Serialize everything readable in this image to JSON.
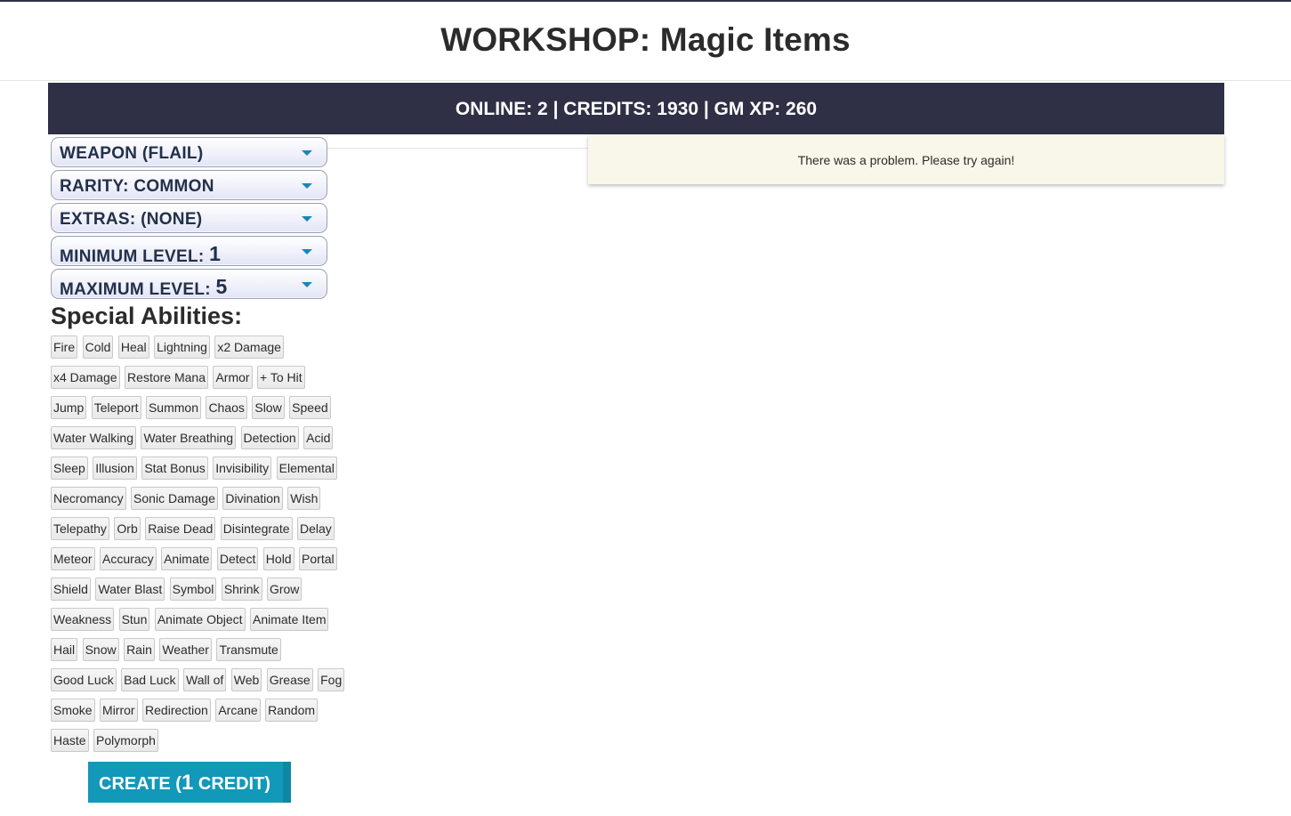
{
  "page": {
    "title": "WORKSHOP: Magic Items"
  },
  "status": {
    "text": "ONLINE: 2 | CREDITS: 1930 | GM XP: 260"
  },
  "alert": {
    "message": "There was a problem. Please try again!"
  },
  "filters": {
    "item_type": "WEAPON (FLAIL)",
    "rarity": "RARITY: COMMON",
    "extras": "EXTRAS: (NONE)",
    "min_level_label": "MINIMUM LEVEL: ",
    "min_level_value": "1",
    "max_level_label": "MAXIMUM LEVEL: ",
    "max_level_value": "5"
  },
  "abilities": {
    "heading": "Special Abilities:",
    "rows": [
      [
        "Fire",
        "Cold",
        "Heal",
        "Lightning",
        "x2 Damage"
      ],
      [
        "x4 Damage",
        "Restore Mana",
        "Armor",
        "+ To Hit"
      ],
      [
        "Jump",
        "Teleport",
        "Summon",
        "Chaos",
        "Slow",
        "Speed"
      ],
      [
        "Water Walking",
        "Water Breathing",
        "Detection",
        "Acid"
      ],
      [
        "Sleep",
        "Illusion",
        "Stat Bonus",
        "Invisibility",
        "Elemental"
      ],
      [
        "Necromancy",
        "Sonic Damage",
        "Divination",
        "Wish"
      ],
      [
        "Telepathy",
        "Orb",
        "Raise Dead",
        "Disintegrate",
        "Delay"
      ],
      [
        "Meteor",
        "Accuracy",
        "Animate",
        "Detect",
        "Hold",
        "Portal"
      ],
      [
        "Shield",
        "Water Blast",
        "Symbol",
        "Shrink",
        "Grow"
      ],
      [
        "Weakness",
        "Stun",
        "Animate Object",
        "Animate Item"
      ],
      [
        "Hail",
        "Snow",
        "Rain",
        "Weather",
        "Transmute"
      ],
      [
        "Good Luck",
        "Bad Luck",
        "Wall of",
        "Web",
        "Grease",
        "Fog"
      ],
      [
        "Smoke",
        "Mirror",
        "Redirection",
        "Arcane",
        "Random"
      ],
      [
        "Haste",
        "Polymorph"
      ]
    ]
  },
  "create_button": {
    "label_prefix": "CREATE (",
    "credit_count": "1",
    "label_suffix": " CREDIT)"
  },
  "colors": {
    "navy": "#2f3045",
    "button_teal": "#1298b8",
    "caret_blue": "#1688b8",
    "alert_bg": "#f8f7ea"
  }
}
